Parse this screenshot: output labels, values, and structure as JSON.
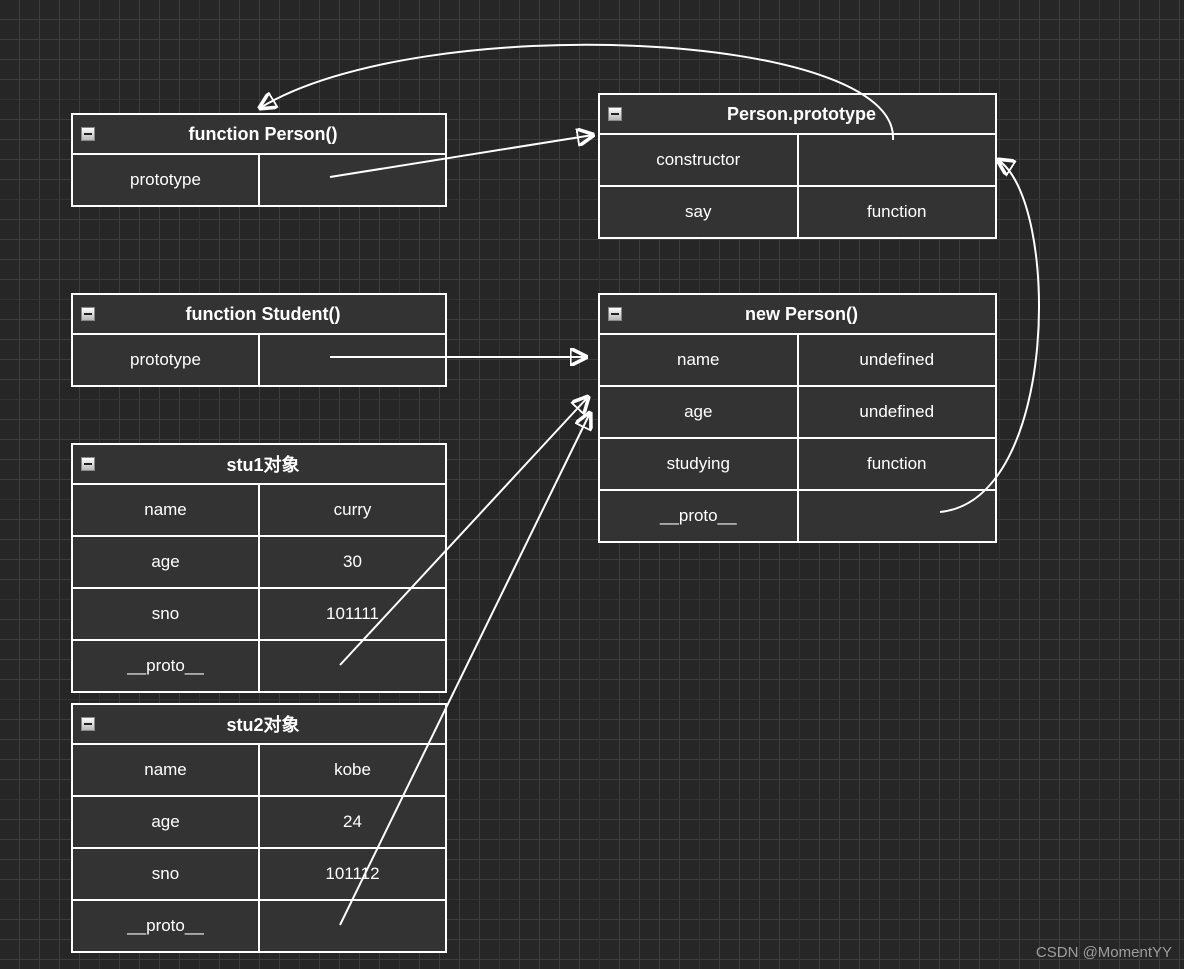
{
  "boxes": {
    "personFn": {
      "title": "function Person()",
      "rows": [
        {
          "key": "prototype",
          "value": ""
        }
      ]
    },
    "studentFn": {
      "title": "function Student()",
      "rows": [
        {
          "key": "prototype",
          "value": ""
        }
      ]
    },
    "stu1": {
      "title": "stu1对象",
      "rows": [
        {
          "key": "name",
          "value": "curry"
        },
        {
          "key": "age",
          "value": "30"
        },
        {
          "key": "sno",
          "value": "101111"
        },
        {
          "key": "__proto__",
          "value": ""
        }
      ]
    },
    "stu2": {
      "title": "stu2对象",
      "rows": [
        {
          "key": "name",
          "value": "kobe"
        },
        {
          "key": "age",
          "value": "24"
        },
        {
          "key": "sno",
          "value": "101112"
        },
        {
          "key": "__proto__",
          "value": ""
        }
      ]
    },
    "personProto": {
      "title": "Person.prototype",
      "rows": [
        {
          "key": "constructor",
          "value": ""
        },
        {
          "key": "say",
          "value": "function"
        }
      ]
    },
    "newPerson": {
      "title": "new Person()",
      "rows": [
        {
          "key": "name",
          "value": "undefined"
        },
        {
          "key": "age",
          "value": "undefined"
        },
        {
          "key": "studying",
          "value": "function"
        },
        {
          "key": "__proto__",
          "value": ""
        }
      ]
    }
  },
  "watermark": "CSDN @MomentYY"
}
